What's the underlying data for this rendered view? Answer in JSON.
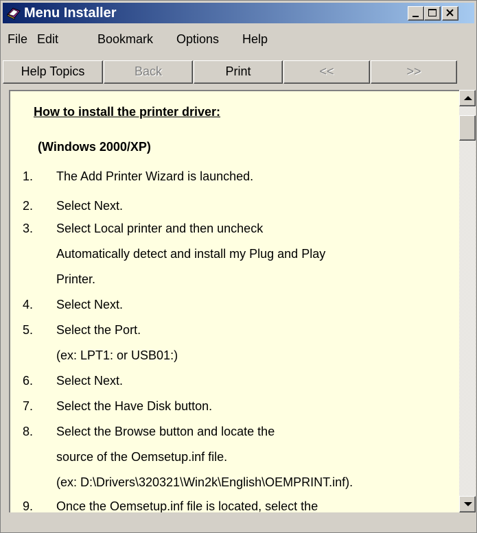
{
  "window": {
    "title": "Menu Installer"
  },
  "menu": [
    "File",
    "Edit",
    "Bookmark",
    "Options",
    "Help"
  ],
  "toolbar": {
    "help_topics": "Help Topics",
    "back": "Back",
    "print": "Print",
    "prev": "<<",
    "next": ">>"
  },
  "content": {
    "heading": "How to install the printer driver:",
    "subheading": "(Windows 2000/XP)",
    "steps": [
      {
        "num": "1.",
        "lines": [
          "The Add Printer Wizard is launched."
        ]
      },
      {
        "num": "2.",
        "lines": [
          "Select Next."
        ]
      },
      {
        "num": "3.",
        "lines": [
          "Select Local printer and then uncheck",
          "Automatically detect and install my Plug and Play",
          "Printer."
        ]
      },
      {
        "num": "4.",
        "lines": [
          "Select Next."
        ]
      },
      {
        "num": "5.",
        "lines": [
          "Select the Port.",
          "(ex: LPT1: or USB01:)"
        ]
      },
      {
        "num": "6.",
        "lines": [
          "Select Next."
        ]
      },
      {
        "num": "7.",
        "lines": [
          "Select the Have Disk button."
        ]
      },
      {
        "num": "8.",
        "lines": [
          "Select the Browse button and locate the",
          " source of the Oemsetup.inf file.",
          "(ex: D:\\Drivers\\320321\\Win2k\\English\\OEMPRINT.inf)."
        ]
      },
      {
        "num": "9.",
        "lines": [
          "Once the Oemsetup.inf file is located, select the"
        ]
      }
    ]
  },
  "icons": {
    "app": "book-icon",
    "minimize": "minimize-icon",
    "maximize": "maximize-icon",
    "close": "close-icon",
    "scroll_up": "arrow-up-icon",
    "scroll_down": "arrow-down-icon"
  },
  "colors": {
    "title_start": "#0a246a",
    "title_end": "#a6caf0",
    "content_bg": "#ffffe1",
    "chrome": "#d4d0c8"
  }
}
